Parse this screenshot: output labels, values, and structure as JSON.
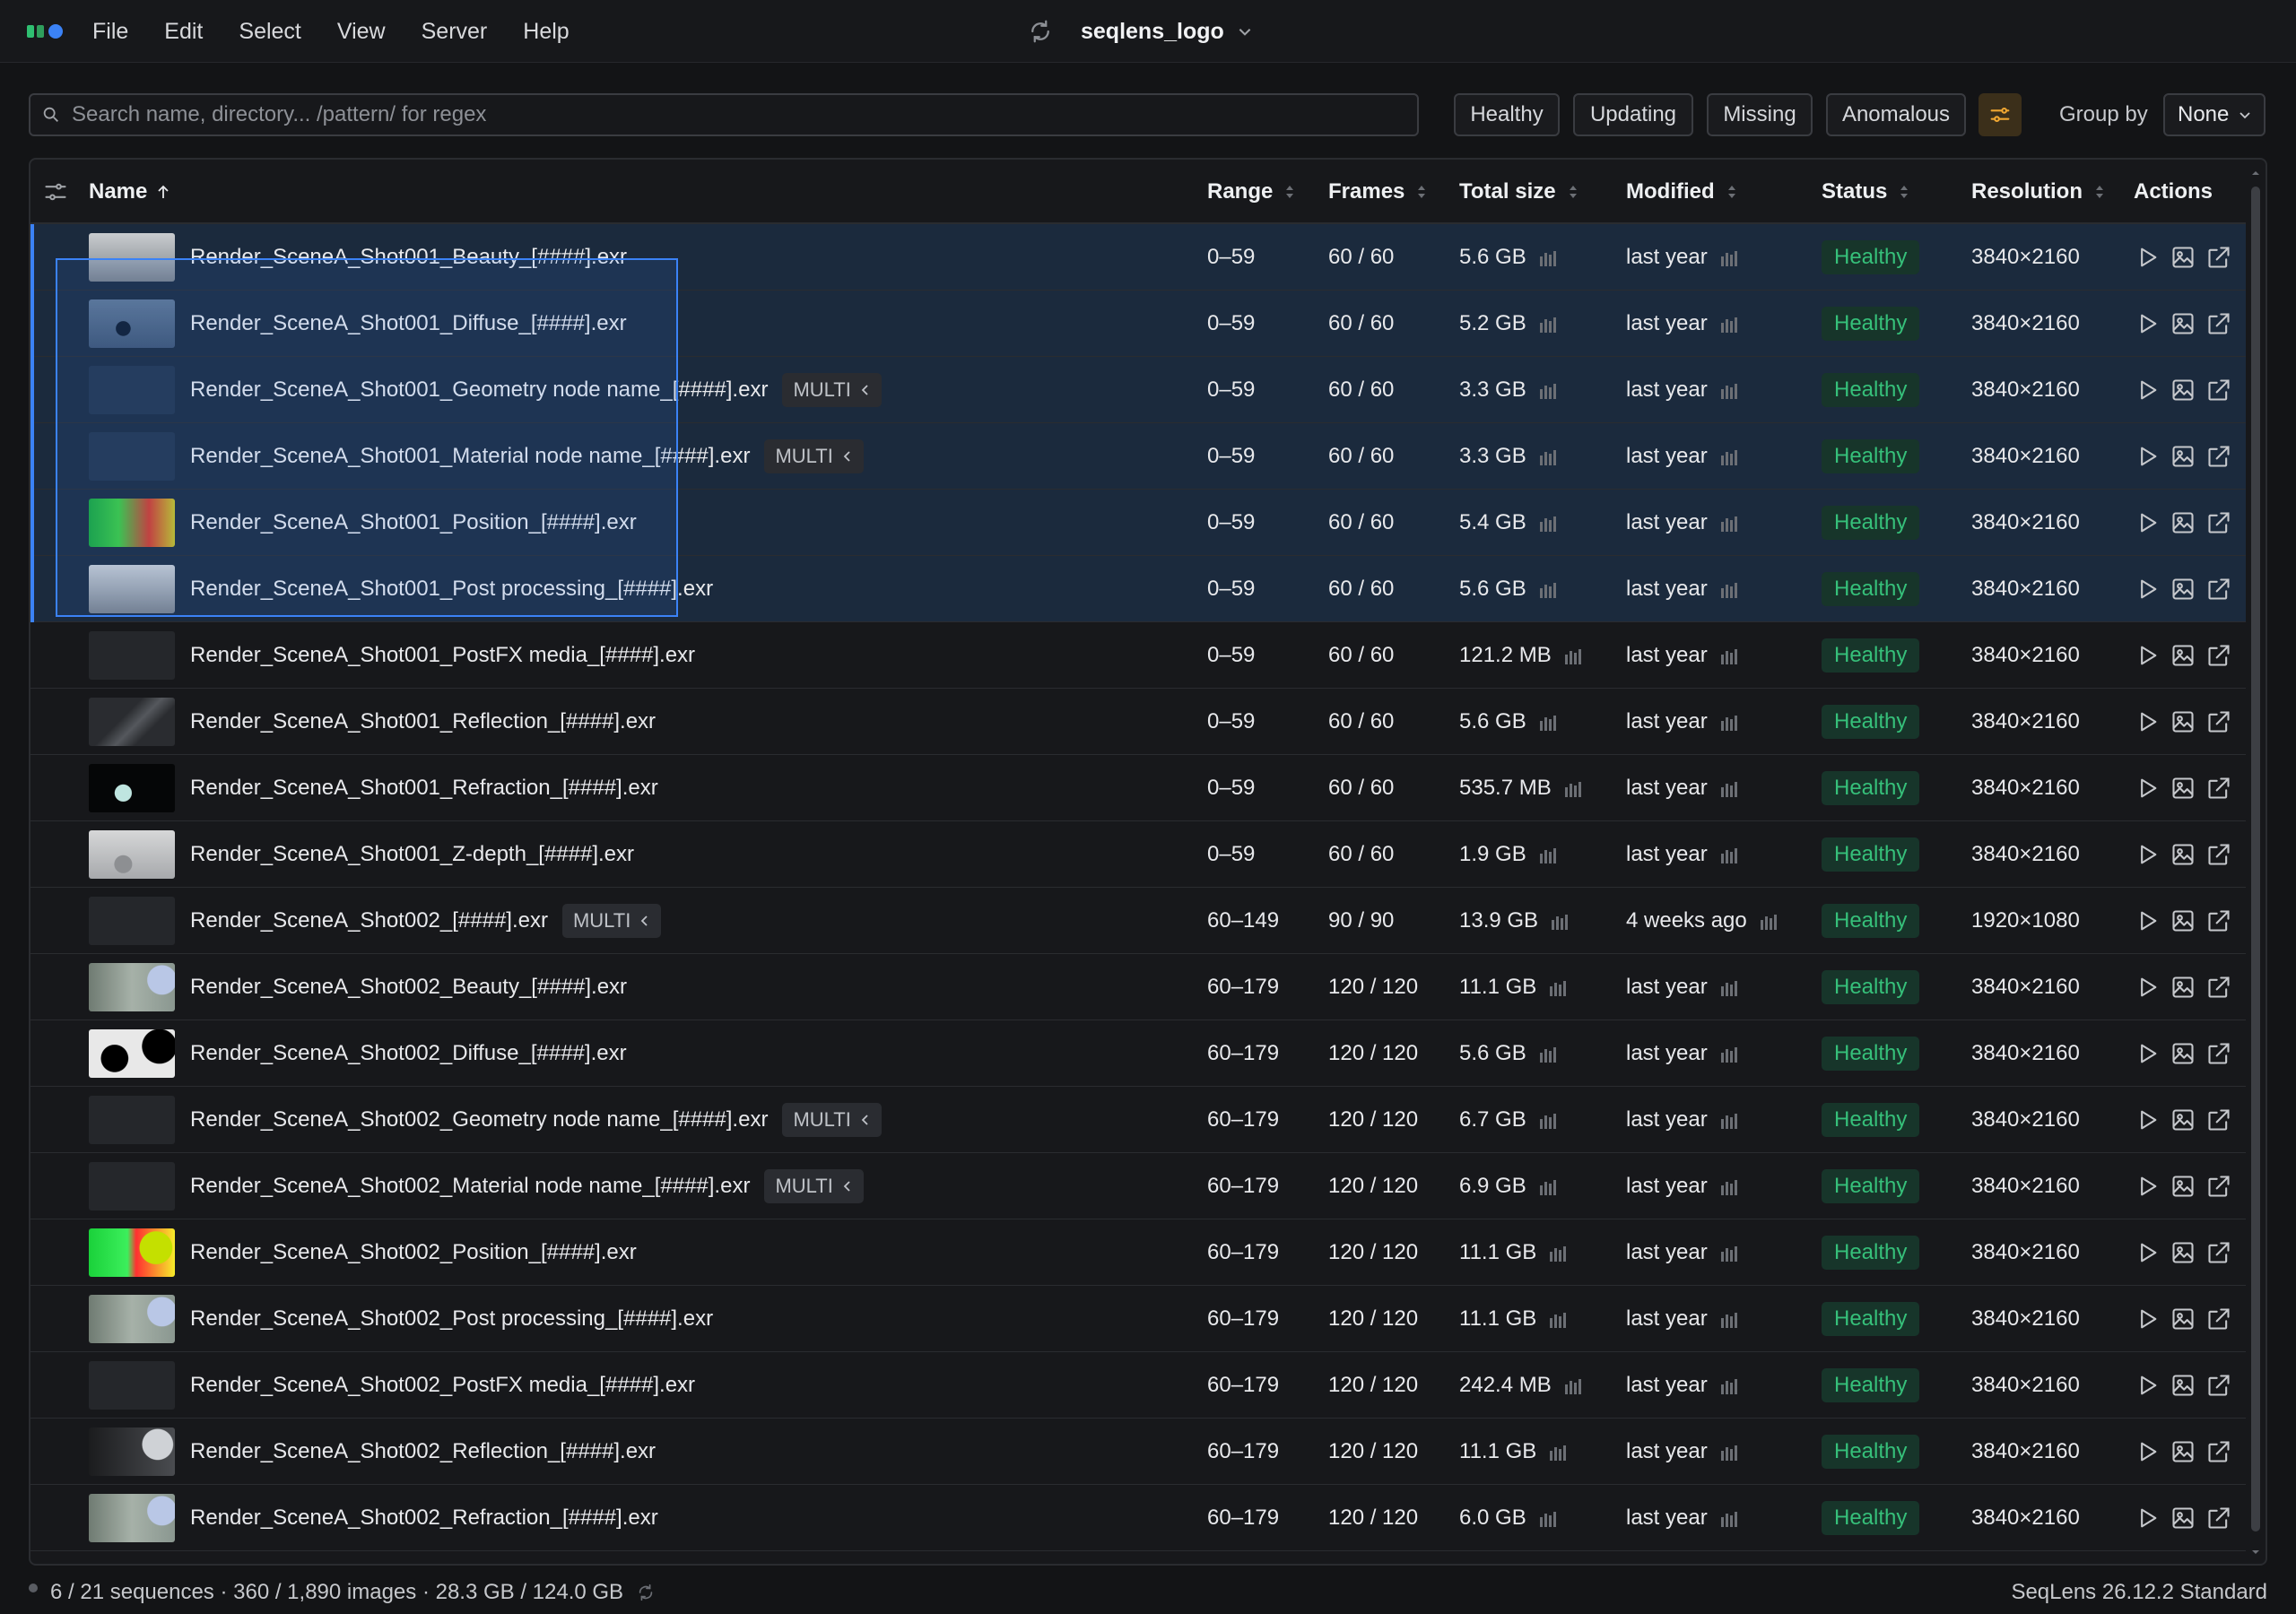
{
  "menu": [
    "File",
    "Edit",
    "Select",
    "View",
    "Server",
    "Help"
  ],
  "project": {
    "name": "seqlens_logo"
  },
  "search": {
    "placeholder": "Search name, directory... /pattern/ for regex"
  },
  "filters": [
    {
      "label": "Healthy"
    },
    {
      "label": "Updating"
    },
    {
      "label": "Missing"
    },
    {
      "label": "Anomalous"
    }
  ],
  "group": {
    "label": "Group by",
    "value": "None"
  },
  "columns": {
    "name": "Name",
    "range": "Range",
    "frames": "Frames",
    "size": "Total size",
    "modified": "Modified",
    "status": "Status",
    "resolution": "Resolution",
    "actions": "Actions"
  },
  "rows": [
    {
      "name": "Render_SceneA_Shot001_Beauty_[####].exr",
      "multi": "",
      "range": "0–59",
      "frames": "60 / 60",
      "size": "5.6 GB",
      "modified": "last year",
      "status": "Healthy",
      "res": "3840×2160",
      "thumb": "beauty1",
      "selected": true
    },
    {
      "name": "Render_SceneA_Shot001_Diffuse_[####].exr",
      "multi": "",
      "range": "0–59",
      "frames": "60 / 60",
      "size": "5.2 GB",
      "modified": "last year",
      "status": "Healthy",
      "res": "3840×2160",
      "thumb": "diffuse1",
      "selected": true
    },
    {
      "name": "Render_SceneA_Shot001_Geometry node name_[####].exr",
      "multi": "MULTI",
      "range": "0–59",
      "frames": "60 / 60",
      "size": "3.3 GB",
      "modified": "last year",
      "status": "Healthy",
      "res": "3840×2160",
      "thumb": "blue",
      "selected": true
    },
    {
      "name": "Render_SceneA_Shot001_Material node name_[####].exr",
      "multi": "MULTI",
      "range": "0–59",
      "frames": "60 / 60",
      "size": "3.3 GB",
      "modified": "last year",
      "status": "Healthy",
      "res": "3840×2160",
      "thumb": "blue",
      "selected": true
    },
    {
      "name": "Render_SceneA_Shot001_Position_[####].exr",
      "multi": "",
      "range": "0–59",
      "frames": "60 / 60",
      "size": "5.4 GB",
      "modified": "last year",
      "status": "Healthy",
      "res": "3840×2160",
      "thumb": "position1",
      "selected": true
    },
    {
      "name": "Render_SceneA_Shot001_Post processing_[####].exr",
      "multi": "",
      "range": "0–59",
      "frames": "60 / 60",
      "size": "5.6 GB",
      "modified": "last year",
      "status": "Healthy",
      "res": "3840×2160",
      "thumb": "beauty1",
      "selected": true
    },
    {
      "name": "Render_SceneA_Shot001_PostFX media_[####].exr",
      "multi": "",
      "range": "0–59",
      "frames": "60 / 60",
      "size": "121.2 MB",
      "modified": "last year",
      "status": "Healthy",
      "res": "3840×2160",
      "thumb": "dark",
      "selected": false
    },
    {
      "name": "Render_SceneA_Shot001_Reflection_[####].exr",
      "multi": "",
      "range": "0–59",
      "frames": "60 / 60",
      "size": "5.6 GB",
      "modified": "last year",
      "status": "Healthy",
      "res": "3840×2160",
      "thumb": "reflect1",
      "selected": false
    },
    {
      "name": "Render_SceneA_Shot001_Refraction_[####].exr",
      "multi": "",
      "range": "0–59",
      "frames": "60 / 60",
      "size": "535.7 MB",
      "modified": "last year",
      "status": "Healthy",
      "res": "3840×2160",
      "thumb": "refract1",
      "selected": false
    },
    {
      "name": "Render_SceneA_Shot001_Z-depth_[####].exr",
      "multi": "",
      "range": "0–59",
      "frames": "60 / 60",
      "size": "1.9 GB",
      "modified": "last year",
      "status": "Healthy",
      "res": "3840×2160",
      "thumb": "zdepth",
      "selected": false
    },
    {
      "name": "Render_SceneA_Shot002_[####].exr",
      "multi": "MULTI",
      "range": "60–149",
      "frames": "90 / 90",
      "size": "13.9 GB",
      "modified": "4 weeks ago",
      "status": "Healthy",
      "res": "1920×1080",
      "thumb": "dark",
      "selected": false
    },
    {
      "name": "Render_SceneA_Shot002_Beauty_[####].exr",
      "multi": "",
      "range": "60–179",
      "frames": "120 / 120",
      "size": "11.1 GB",
      "modified": "last year",
      "status": "Healthy",
      "res": "3840×2160",
      "thumb": "beauty2",
      "selected": false
    },
    {
      "name": "Render_SceneA_Shot002_Diffuse_[####].exr",
      "multi": "",
      "range": "60–179",
      "frames": "120 / 120",
      "size": "5.6 GB",
      "modified": "last year",
      "status": "Healthy",
      "res": "3840×2160",
      "thumb": "diffuse2",
      "selected": false
    },
    {
      "name": "Render_SceneA_Shot002_Geometry node name_[####].exr",
      "multi": "MULTI",
      "range": "60–179",
      "frames": "120 / 120",
      "size": "6.7 GB",
      "modified": "last year",
      "status": "Healthy",
      "res": "3840×2160",
      "thumb": "dark",
      "selected": false
    },
    {
      "name": "Render_SceneA_Shot002_Material node name_[####].exr",
      "multi": "MULTI",
      "range": "60–179",
      "frames": "120 / 120",
      "size": "6.9 GB",
      "modified": "last year",
      "status": "Healthy",
      "res": "3840×2160",
      "thumb": "dark",
      "selected": false
    },
    {
      "name": "Render_SceneA_Shot002_Position_[####].exr",
      "multi": "",
      "range": "60–179",
      "frames": "120 / 120",
      "size": "11.1 GB",
      "modified": "last year",
      "status": "Healthy",
      "res": "3840×2160",
      "thumb": "position2",
      "selected": false
    },
    {
      "name": "Render_SceneA_Shot002_Post processing_[####].exr",
      "multi": "",
      "range": "60–179",
      "frames": "120 / 120",
      "size": "11.1 GB",
      "modified": "last year",
      "status": "Healthy",
      "res": "3840×2160",
      "thumb": "beauty2",
      "selected": false
    },
    {
      "name": "Render_SceneA_Shot002_PostFX media_[####].exr",
      "multi": "",
      "range": "60–179",
      "frames": "120 / 120",
      "size": "242.4 MB",
      "modified": "last year",
      "status": "Healthy",
      "res": "3840×2160",
      "thumb": "dark",
      "selected": false
    },
    {
      "name": "Render_SceneA_Shot002_Reflection_[####].exr",
      "multi": "",
      "range": "60–179",
      "frames": "120 / 120",
      "size": "11.1 GB",
      "modified": "last year",
      "status": "Healthy",
      "res": "3840×2160",
      "thumb": "reflect2",
      "selected": false
    },
    {
      "name": "Render_SceneA_Shot002_Refraction_[####].exr",
      "multi": "",
      "range": "60–179",
      "frames": "120 / 120",
      "size": "6.0 GB",
      "modified": "last year",
      "status": "Healthy",
      "res": "3840×2160",
      "thumb": "beauty2",
      "selected": false
    }
  ],
  "status": {
    "summary": "6 / 21 sequences · 360 / 1,890 images · 28.3 GB / 124.0 GB",
    "version": "SeqLens 26.12.2 Standard"
  },
  "colors": {
    "accent": "#3b82f6",
    "healthy": "#36c07a",
    "healthy_bg": "#17352a",
    "filter_active": "#f0a732"
  }
}
